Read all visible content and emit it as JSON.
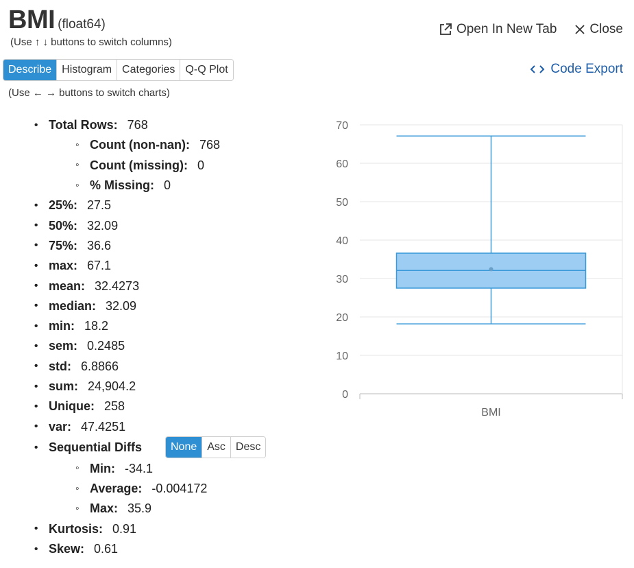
{
  "column": {
    "name": "BMI",
    "dtype": "(float64)"
  },
  "hints": {
    "switch_columns": "(Use ↑ ↓ buttons to switch columns)",
    "switch_charts": "(Use ← → buttons to switch charts)"
  },
  "chart_tabs": [
    {
      "label": "Describe",
      "active": true
    },
    {
      "label": "Histogram",
      "active": false
    },
    {
      "label": "Categories",
      "active": false
    },
    {
      "label": "Q-Q Plot",
      "active": false
    }
  ],
  "actions": {
    "open_new_tab": "Open In New Tab",
    "close": "Close",
    "code_export": "Code Export"
  },
  "stats": {
    "total_rows": {
      "label": "Total Rows:",
      "value": "768"
    },
    "count_non_nan": {
      "label": "Count (non-nan):",
      "value": "768"
    },
    "count_missing": {
      "label": "Count (missing):",
      "value": "0"
    },
    "pct_missing": {
      "label": "% Missing:",
      "value": "0"
    },
    "p25": {
      "label": "25%:",
      "value": "27.5"
    },
    "p50": {
      "label": "50%:",
      "value": "32.09"
    },
    "p75": {
      "label": "75%:",
      "value": "36.6"
    },
    "max": {
      "label": "max:",
      "value": "67.1"
    },
    "mean": {
      "label": "mean:",
      "value": "32.4273"
    },
    "median": {
      "label": "median:",
      "value": "32.09"
    },
    "min": {
      "label": "min:",
      "value": "18.2"
    },
    "sem": {
      "label": "sem:",
      "value": "0.2485"
    },
    "std": {
      "label": "std:",
      "value": "6.8866"
    },
    "sum": {
      "label": "sum:",
      "value": "24,904.2"
    },
    "unique": {
      "label": "Unique:",
      "value": "258"
    },
    "var": {
      "label": "var:",
      "value": "47.4251"
    },
    "seq_diffs": {
      "label": "Sequential Diffs",
      "buttons": [
        {
          "label": "None",
          "active": true
        },
        {
          "label": "Asc",
          "active": false
        },
        {
          "label": "Desc",
          "active": false
        }
      ],
      "min": {
        "label": "Min:",
        "value": "-34.1"
      },
      "average": {
        "label": "Average:",
        "value": "-0.004172"
      },
      "max": {
        "label": "Max:",
        "value": "35.9"
      }
    },
    "kurtosis": {
      "label": "Kurtosis:",
      "value": "0.91"
    },
    "skew": {
      "label": "Skew:",
      "value": "0.61"
    }
  },
  "chart_data": {
    "type": "boxplot",
    "categories": [
      "BMI"
    ],
    "box": {
      "min": 18.2,
      "q1": 27.5,
      "median": 32.09,
      "q3": 36.6,
      "max": 67.1,
      "mean": 32.4273
    },
    "yticks": [
      0,
      10,
      20,
      30,
      40,
      50,
      60,
      70
    ],
    "ylim": [
      0,
      70
    ],
    "grid": true,
    "colors": {
      "box_fill": "#9dcdf2",
      "box_stroke": "#3a9ad9",
      "grid": "#e6e6e6"
    }
  }
}
